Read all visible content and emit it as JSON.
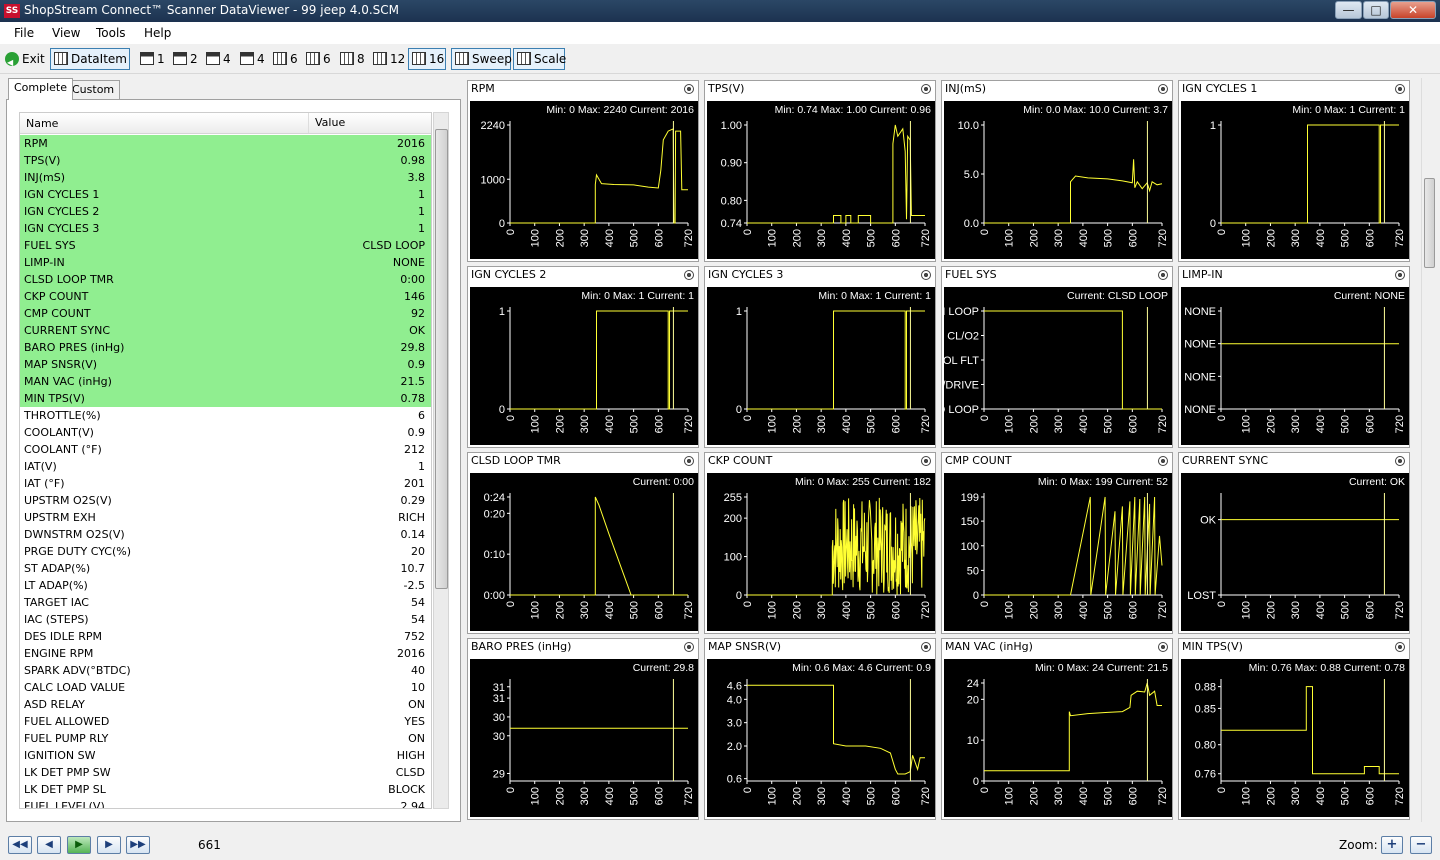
{
  "window": {
    "title": "ShopStream Connect™ Scanner DataViewer - 99 jeep 4.0.SCM",
    "logo": "SS",
    "minimize": "—",
    "maximize": "□",
    "close": "✕"
  },
  "menu": [
    "File",
    "View",
    "Tools",
    "Help"
  ],
  "toolbar": {
    "exit": "Exit",
    "dataitem": "DataItem",
    "layouts": [
      "1",
      "2",
      "4",
      "4",
      "6",
      "6",
      "8",
      "12",
      "16"
    ],
    "sweep": "Sweep",
    "scale": "Scale"
  },
  "tabs": {
    "complete": "Complete",
    "custom": "Custom"
  },
  "list": {
    "headers": {
      "name": "Name",
      "value": "Value"
    },
    "rows": [
      {
        "name": "RPM",
        "value": "2016",
        "hl": true
      },
      {
        "name": "TPS(V)",
        "value": "0.98",
        "hl": true
      },
      {
        "name": "INJ(mS)",
        "value": "3.8",
        "hl": true
      },
      {
        "name": "IGN CYCLES 1",
        "value": "1",
        "hl": true
      },
      {
        "name": "IGN CYCLES 2",
        "value": "1",
        "hl": true
      },
      {
        "name": "IGN CYCLES 3",
        "value": "1",
        "hl": true
      },
      {
        "name": "FUEL SYS",
        "value": "CLSD LOOP",
        "hl": true
      },
      {
        "name": "LIMP-IN",
        "value": "NONE",
        "hl": true
      },
      {
        "name": "CLSD LOOP TMR",
        "value": "0:00",
        "hl": true
      },
      {
        "name": "CKP COUNT",
        "value": "146",
        "hl": true
      },
      {
        "name": "CMP COUNT",
        "value": "92",
        "hl": true
      },
      {
        "name": "CURRENT SYNC",
        "value": "OK",
        "hl": true
      },
      {
        "name": "BARO PRES (inHg)",
        "value": "29.8",
        "hl": true
      },
      {
        "name": "MAP SNSR(V)",
        "value": "0.9",
        "hl": true
      },
      {
        "name": "MAN VAC (inHg)",
        "value": "21.5",
        "hl": true
      },
      {
        "name": "MIN TPS(V)",
        "value": "0.78",
        "hl": true
      },
      {
        "name": "THROTTLE(%)",
        "value": "6",
        "hl": false
      },
      {
        "name": "COOLANT(V)",
        "value": "0.9",
        "hl": false
      },
      {
        "name": "COOLANT (°F)",
        "value": "212",
        "hl": false
      },
      {
        "name": "IAT(V)",
        "value": "1",
        "hl": false
      },
      {
        "name": "IAT (°F)",
        "value": "201",
        "hl": false
      },
      {
        "name": "UPSTRM O2S(V)",
        "value": "0.29",
        "hl": false
      },
      {
        "name": "UPSTRM EXH",
        "value": "RICH",
        "hl": false
      },
      {
        "name": "DWNSTRM O2S(V)",
        "value": "0.14",
        "hl": false
      },
      {
        "name": "PRGE DUTY CYC(%)",
        "value": "20",
        "hl": false
      },
      {
        "name": "ST ADAP(%)",
        "value": "10.7",
        "hl": false
      },
      {
        "name": "LT ADAP(%)",
        "value": "-2.5",
        "hl": false
      },
      {
        "name": "TARGET IAC",
        "value": "54",
        "hl": false
      },
      {
        "name": "IAC (STEPS)",
        "value": "54",
        "hl": false
      },
      {
        "name": "DES IDLE RPM",
        "value": "752",
        "hl": false
      },
      {
        "name": "ENGINE RPM",
        "value": "2016",
        "hl": false
      },
      {
        "name": "SPARK ADV(°BTDC)",
        "value": "40",
        "hl": false
      },
      {
        "name": "CALC LOAD VALUE",
        "value": "10",
        "hl": false
      },
      {
        "name": "ASD RELAY",
        "value": "ON",
        "hl": false
      },
      {
        "name": "FUEL ALLOWED",
        "value": "YES",
        "hl": false
      },
      {
        "name": "FUEL PUMP RLY",
        "value": "ON",
        "hl": false
      },
      {
        "name": "IGNITION SW",
        "value": "HIGH",
        "hl": false
      },
      {
        "name": "LK DET PMP SW",
        "value": "CLSD",
        "hl": false
      },
      {
        "name": "LK DET PMP SL",
        "value": "BLOCK",
        "hl": false
      },
      {
        "name": "FUEL LEVEL(V)",
        "value": "2.94",
        "hl": false
      }
    ]
  },
  "colors": {
    "plot_bg": "#000000",
    "trace": "#ffff33",
    "text": "#ffffff",
    "highlight": "#90ee90"
  },
  "x_ticks": [
    "0",
    "100",
    "200",
    "300",
    "400",
    "500",
    "600",
    "720"
  ],
  "graphs": [
    {
      "title": "RPM",
      "stats": [
        "Min: 0",
        "Max: 2240",
        "Current: 2016"
      ],
      "yticks": [
        {
          "v": 0,
          "l": "0"
        },
        {
          "v": 1000,
          "l": "1000"
        },
        {
          "v": 2240,
          "l": "2240"
        }
      ],
      "ymin": 0,
      "ymax": 2240,
      "trace": [
        [
          0,
          0
        ],
        [
          345,
          0
        ],
        [
          345,
          880
        ],
        [
          350,
          1100
        ],
        [
          370,
          900
        ],
        [
          420,
          880
        ],
        [
          500,
          870
        ],
        [
          560,
          820
        ],
        [
          600,
          800
        ],
        [
          610,
          1200
        ],
        [
          620,
          1900
        ],
        [
          640,
          2100
        ],
        [
          660,
          2150
        ],
        [
          663,
          0
        ],
        [
          668,
          0
        ],
        [
          670,
          2100
        ],
        [
          690,
          2100
        ],
        [
          695,
          760
        ],
        [
          720,
          760
        ]
      ]
    },
    {
      "title": "TPS(V)",
      "stats": [
        "Min: 0.74",
        "Max: 1.00",
        "Current: 0.96"
      ],
      "yticks": [
        {
          "v": 0.74,
          "l": "0.74"
        },
        {
          "v": 0.8,
          "l": "0.80"
        },
        {
          "v": 0.9,
          "l": "0.90"
        },
        {
          "v": 1.0,
          "l": "1.00"
        }
      ],
      "ymin": 0.74,
      "ymax": 1.0,
      "trace": [
        [
          0,
          0.74
        ],
        [
          350,
          0.74
        ],
        [
          350,
          0.76
        ],
        [
          380,
          0.76
        ],
        [
          380,
          0.74
        ],
        [
          400,
          0.74
        ],
        [
          400,
          0.76
        ],
        [
          420,
          0.76
        ],
        [
          420,
          0.74
        ],
        [
          450,
          0.74
        ],
        [
          450,
          0.76
        ],
        [
          500,
          0.76
        ],
        [
          500,
          0.74
        ],
        [
          590,
          0.74
        ],
        [
          590,
          0.95
        ],
        [
          600,
          1.0
        ],
        [
          610,
          0.97
        ],
        [
          630,
          0.99
        ],
        [
          640,
          0.93
        ],
        [
          645,
          0.75
        ],
        [
          650,
          0.97
        ],
        [
          660,
          0.96
        ],
        [
          665,
          0.76
        ],
        [
          720,
          0.76
        ]
      ]
    },
    {
      "title": "INJ(mS)",
      "stats": [
        "Min: 0.0",
        "Max: 10.0",
        "Current: 3.7"
      ],
      "yticks": [
        {
          "v": 0,
          "l": "0.0"
        },
        {
          "v": 5,
          "l": "5.0"
        },
        {
          "v": 10,
          "l": "10.0"
        }
      ],
      "ymin": 0,
      "ymax": 10,
      "trace": [
        [
          0,
          0
        ],
        [
          350,
          0
        ],
        [
          350,
          4.2
        ],
        [
          370,
          4.8
        ],
        [
          420,
          4.6
        ],
        [
          500,
          4.5
        ],
        [
          560,
          4.3
        ],
        [
          600,
          4.1
        ],
        [
          605,
          6.5
        ],
        [
          610,
          3.6
        ],
        [
          620,
          4.2
        ],
        [
          640,
          3.5
        ],
        [
          660,
          4.1
        ],
        [
          670,
          3.3
        ],
        [
          680,
          4.2
        ],
        [
          700,
          3.9
        ],
        [
          720,
          4.0
        ]
      ]
    },
    {
      "title": "IGN CYCLES 1",
      "stats": [
        "Min: 0",
        "Max: 1",
        "Current: 1"
      ],
      "yticks": [
        {
          "v": 0,
          "l": "0"
        },
        {
          "v": 1,
          "l": "1"
        }
      ],
      "ymin": 0,
      "ymax": 1,
      "trace": [
        [
          0,
          0
        ],
        [
          350,
          0
        ],
        [
          350,
          1
        ],
        [
          640,
          1
        ],
        [
          640,
          0
        ],
        [
          645,
          0
        ],
        [
          645,
          1
        ],
        [
          720,
          1
        ]
      ]
    },
    {
      "title": "IGN CYCLES 2",
      "stats": [
        "Min: 0",
        "Max: 1",
        "Current: 1"
      ],
      "yticks": [
        {
          "v": 0,
          "l": "0"
        },
        {
          "v": 1,
          "l": "1"
        }
      ],
      "ymin": 0,
      "ymax": 1,
      "trace": [
        [
          0,
          0
        ],
        [
          350,
          0
        ],
        [
          350,
          1
        ],
        [
          640,
          1
        ],
        [
          640,
          0
        ],
        [
          645,
          0
        ],
        [
          645,
          1
        ],
        [
          720,
          1
        ]
      ]
    },
    {
      "title": "IGN CYCLES 3",
      "stats": [
        "Min: 0",
        "Max: 1",
        "Current: 1"
      ],
      "yticks": [
        {
          "v": 0,
          "l": "0"
        },
        {
          "v": 1,
          "l": "1"
        }
      ],
      "ymin": 0,
      "ymax": 1,
      "trace": [
        [
          0,
          0
        ],
        [
          350,
          0
        ],
        [
          350,
          1
        ],
        [
          640,
          1
        ],
        [
          640,
          0
        ],
        [
          645,
          0
        ],
        [
          645,
          1
        ],
        [
          720,
          1
        ]
      ]
    },
    {
      "title": "FUEL SYS",
      "stats": [
        "Current: CLSD LOOP"
      ],
      "yticks": [
        {
          "v": 0,
          "l": "CLSD LOOP"
        },
        {
          "v": 1,
          "l": "OL/DRIVE"
        },
        {
          "v": 2,
          "l": "OL FLT"
        },
        {
          "v": 3,
          "l": "CL/O2"
        },
        {
          "v": 4,
          "l": "OPEN LOOP"
        }
      ],
      "ymin": 0,
      "ymax": 4,
      "trace": [
        [
          0,
          4
        ],
        [
          560,
          4
        ],
        [
          560,
          0
        ],
        [
          720,
          0
        ]
      ]
    },
    {
      "title": "LIMP-IN",
      "stats": [
        "Current: NONE"
      ],
      "yticks": [
        {
          "v": 0,
          "l": "NONE"
        },
        {
          "v": 1,
          "l": "NONE"
        },
        {
          "v": 2,
          "l": "NONE"
        },
        {
          "v": 3,
          "l": "NONE"
        }
      ],
      "ymin": 0,
      "ymax": 3,
      "trace": [
        [
          0,
          2
        ],
        [
          720,
          2
        ]
      ]
    },
    {
      "title": "CLSD LOOP TMR",
      "stats": [
        "Current: 0:00"
      ],
      "yticks": [
        {
          "v": 0,
          "l": "0:00"
        },
        {
          "v": 0.1,
          "l": "0:10"
        },
        {
          "v": 0.2,
          "l": "0:20"
        },
        {
          "v": 0.24,
          "l": "0:24"
        }
      ],
      "ymin": 0,
      "ymax": 0.24,
      "trace": [
        [
          0,
          0
        ],
        [
          345,
          0
        ],
        [
          345,
          0.24
        ],
        [
          360,
          0.22
        ],
        [
          400,
          0.15
        ],
        [
          460,
          0.05
        ],
        [
          490,
          0
        ],
        [
          720,
          0
        ]
      ]
    },
    {
      "title": "CKP COUNT",
      "stats": [
        "Min: 0",
        "Max: 255",
        "Current: 182"
      ],
      "yticks": [
        {
          "v": 0,
          "l": "0"
        },
        {
          "v": 100,
          "l": "100"
        },
        {
          "v": 200,
          "l": "200"
        },
        {
          "v": 255,
          "l": "255"
        }
      ],
      "ymin": 0,
      "ymax": 255,
      "trace": "noise"
    },
    {
      "title": "CMP COUNT",
      "stats": [
        "Min: 0",
        "Max: 199",
        "Current: 52"
      ],
      "yticks": [
        {
          "v": 0,
          "l": "0"
        },
        {
          "v": 50,
          "l": "50"
        },
        {
          "v": 100,
          "l": "100"
        },
        {
          "v": 150,
          "l": "150"
        },
        {
          "v": 199,
          "l": "199"
        }
      ],
      "ymin": 0,
      "ymax": 199,
      "trace": [
        [
          0,
          0
        ],
        [
          350,
          0
        ],
        [
          430,
          199
        ],
        [
          432,
          0
        ],
        [
          490,
          199
        ],
        [
          492,
          0
        ],
        [
          530,
          170
        ],
        [
          532,
          0
        ],
        [
          560,
          180
        ],
        [
          562,
          0
        ],
        [
          590,
          190
        ],
        [
          592,
          0
        ],
        [
          610,
          199
        ],
        [
          612,
          0
        ],
        [
          630,
          195
        ],
        [
          632,
          0
        ],
        [
          650,
          199
        ],
        [
          652,
          0
        ],
        [
          670,
          185
        ],
        [
          672,
          0
        ],
        [
          690,
          199
        ],
        [
          692,
          0
        ],
        [
          710,
          120
        ],
        [
          720,
          60
        ]
      ]
    },
    {
      "title": "CURRENT SYNC",
      "stats": [
        "Current: OK"
      ],
      "yticks": [
        {
          "v": 0,
          "l": "LOST"
        },
        {
          "v": 1,
          "l": "OK"
        }
      ],
      "ymin": 0,
      "ymax": 1.3,
      "trace": [
        [
          0,
          1
        ],
        [
          720,
          1
        ]
      ]
    },
    {
      "title": "BARO PRES (inHg)",
      "stats": [
        "Current: 29.8"
      ],
      "yticks": [
        {
          "v": 29,
          "l": "29"
        },
        {
          "v": 30,
          "l": "30"
        },
        {
          "v": 30.5,
          "l": "30"
        },
        {
          "v": 31,
          "l": "31"
        },
        {
          "v": 31.3,
          "l": "31"
        }
      ],
      "ymin": 28.8,
      "ymax": 31.4,
      "trace": [
        [
          0,
          30.2
        ],
        [
          720,
          30.2
        ]
      ]
    },
    {
      "title": "MAP SNSR(V)",
      "stats": [
        "Min: 0.6",
        "Max: 4.6",
        "Current: 0.9"
      ],
      "yticks": [
        {
          "v": 0.6,
          "l": "0.6"
        },
        {
          "v": 2,
          "l": "2.0"
        },
        {
          "v": 3,
          "l": "3.0"
        },
        {
          "v": 4,
          "l": "4.0"
        },
        {
          "v": 4.6,
          "l": "4.6"
        }
      ],
      "ymin": 0.5,
      "ymax": 4.7,
      "trace": [
        [
          0,
          4.6
        ],
        [
          350,
          4.6
        ],
        [
          350,
          2.1
        ],
        [
          400,
          2.0
        ],
        [
          480,
          2.0
        ],
        [
          540,
          1.9
        ],
        [
          580,
          1.7
        ],
        [
          600,
          1.0
        ],
        [
          610,
          0.8
        ],
        [
          640,
          0.8
        ],
        [
          660,
          0.9
        ],
        [
          670,
          1.6
        ],
        [
          690,
          1.0
        ],
        [
          700,
          1.5
        ],
        [
          720,
          1.5
        ]
      ]
    },
    {
      "title": "MAN VAC (inHg)",
      "stats": [
        "Min: 0",
        "Max: 24",
        "Current: 21.5"
      ],
      "yticks": [
        {
          "v": 0,
          "l": "0"
        },
        {
          "v": 10,
          "l": "10"
        },
        {
          "v": 20,
          "l": "20"
        },
        {
          "v": 24,
          "l": "24"
        }
      ],
      "ymin": 0,
      "ymax": 24,
      "trace": [
        [
          0,
          2.5
        ],
        [
          345,
          2.5
        ],
        [
          345,
          17
        ],
        [
          350,
          16
        ],
        [
          420,
          16.5
        ],
        [
          500,
          16.8
        ],
        [
          560,
          17
        ],
        [
          590,
          18
        ],
        [
          595,
          21
        ],
        [
          620,
          22
        ],
        [
          650,
          21.8
        ],
        [
          660,
          24
        ],
        [
          670,
          21
        ],
        [
          690,
          22
        ],
        [
          700,
          18.5
        ],
        [
          720,
          18.5
        ]
      ]
    },
    {
      "title": "MIN TPS(V)",
      "stats": [
        "Min: 0.76",
        "Max: 0.88",
        "Current: 0.78"
      ],
      "yticks": [
        {
          "v": 0.76,
          "l": "0.76"
        },
        {
          "v": 0.8,
          "l": "0.80"
        },
        {
          "v": 0.85,
          "l": "0.85"
        },
        {
          "v": 0.88,
          "l": "0.88"
        }
      ],
      "ymin": 0.75,
      "ymax": 0.885,
      "trace": [
        [
          0,
          0.82
        ],
        [
          345,
          0.82
        ],
        [
          345,
          0.88
        ],
        [
          370,
          0.88
        ],
        [
          370,
          0.76
        ],
        [
          580,
          0.76
        ],
        [
          580,
          0.77
        ],
        [
          640,
          0.77
        ],
        [
          640,
          0.76
        ],
        [
          720,
          0.76
        ]
      ]
    }
  ],
  "bottom": {
    "frame": "661",
    "zoom_label": "Zoom:",
    "zoom_in": "+",
    "zoom_out": "−"
  }
}
